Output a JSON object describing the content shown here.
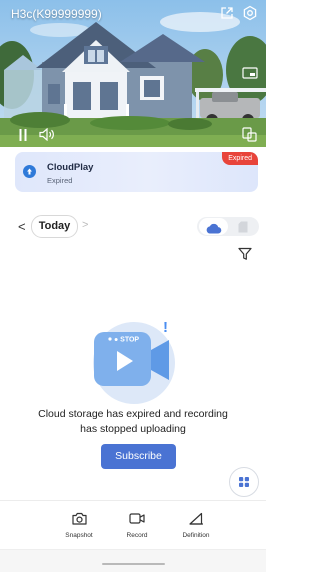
{
  "video": {
    "camera_name": "H3c(K99999999)",
    "icons": [
      "share-icon",
      "settings-icon",
      "picture-in-picture-icon",
      "pause-icon",
      "volume-icon",
      "multi-view-icon"
    ]
  },
  "cloud_card": {
    "title": "CloudPlay",
    "status": "Expired",
    "badge": "Expired",
    "badge_color": "#e8443a"
  },
  "date_nav": {
    "label": "Today",
    "prev": "<",
    "next": ">"
  },
  "storage_toggle": {
    "selected": "cloud",
    "options": [
      "cloud-icon",
      "sd-card-icon"
    ]
  },
  "empty_state": {
    "stop_label": "● STOP",
    "alert_mark": "!",
    "message_line1": "Cloud storage has expired and recording",
    "message_line2": "has stopped uploading",
    "button_label": "Subscribe"
  },
  "toolbar": {
    "snapshot": "Snapshot",
    "record": "Record",
    "definition": "Definition"
  },
  "colors": {
    "accent": "#4a73d3",
    "expired_red": "#e8443a"
  }
}
